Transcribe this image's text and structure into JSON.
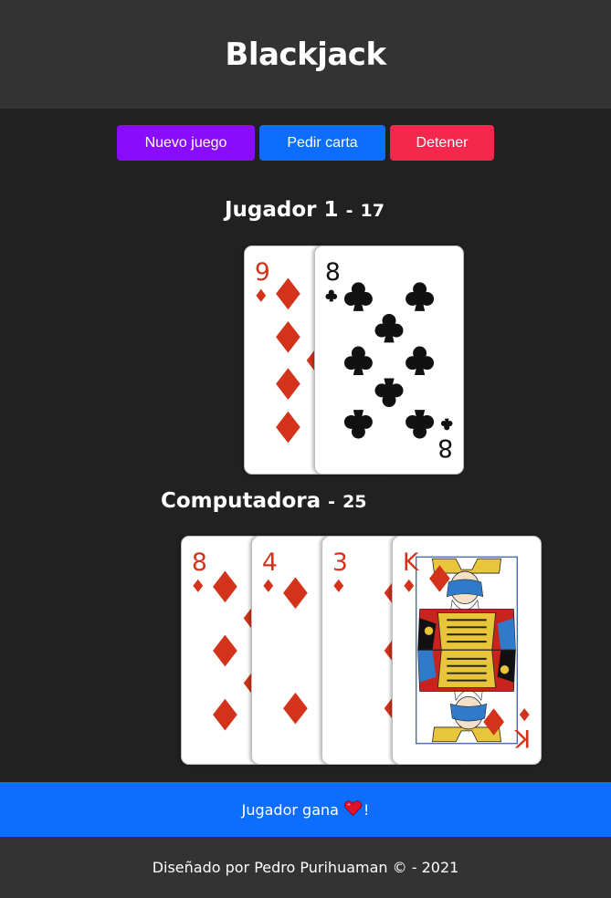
{
  "header": {
    "title": "Blackjack"
  },
  "controls": {
    "new_game": "Nuevo juego",
    "hit": "Pedir carta",
    "stop": "Detener"
  },
  "colors": {
    "new_game": "#8a0cfc",
    "hit": "#0d6efd",
    "stop": "#f5274c",
    "banner": "#0d6efd",
    "background": "#212121",
    "header": "#333333",
    "red_suit": "#d3331a",
    "black_suit": "#111111"
  },
  "player": {
    "name": "Jugador 1",
    "separator": "-",
    "points": "17",
    "cards": [
      {
        "rank": "9",
        "suit": "diamonds",
        "label": "9 of diamonds"
      },
      {
        "rank": "8",
        "suit": "clubs",
        "label": "8 of clubs"
      }
    ]
  },
  "computer": {
    "name": "Computadora",
    "separator": "-",
    "points": "25",
    "cards": [
      {
        "rank": "8",
        "suit": "diamonds",
        "label": "8 of diamonds"
      },
      {
        "rank": "4",
        "suit": "diamonds",
        "label": "4 of diamonds"
      },
      {
        "rank": "3",
        "suit": "diamonds",
        "label": "3 of diamonds"
      },
      {
        "rank": "K",
        "suit": "diamonds",
        "label": "King of diamonds"
      }
    ]
  },
  "result": {
    "text_before": "Jugador gana",
    "icon": "heart-icon",
    "text_after": "!"
  },
  "footer": {
    "text": "Diseñado por Pedro Purihuaman © - 2021"
  }
}
